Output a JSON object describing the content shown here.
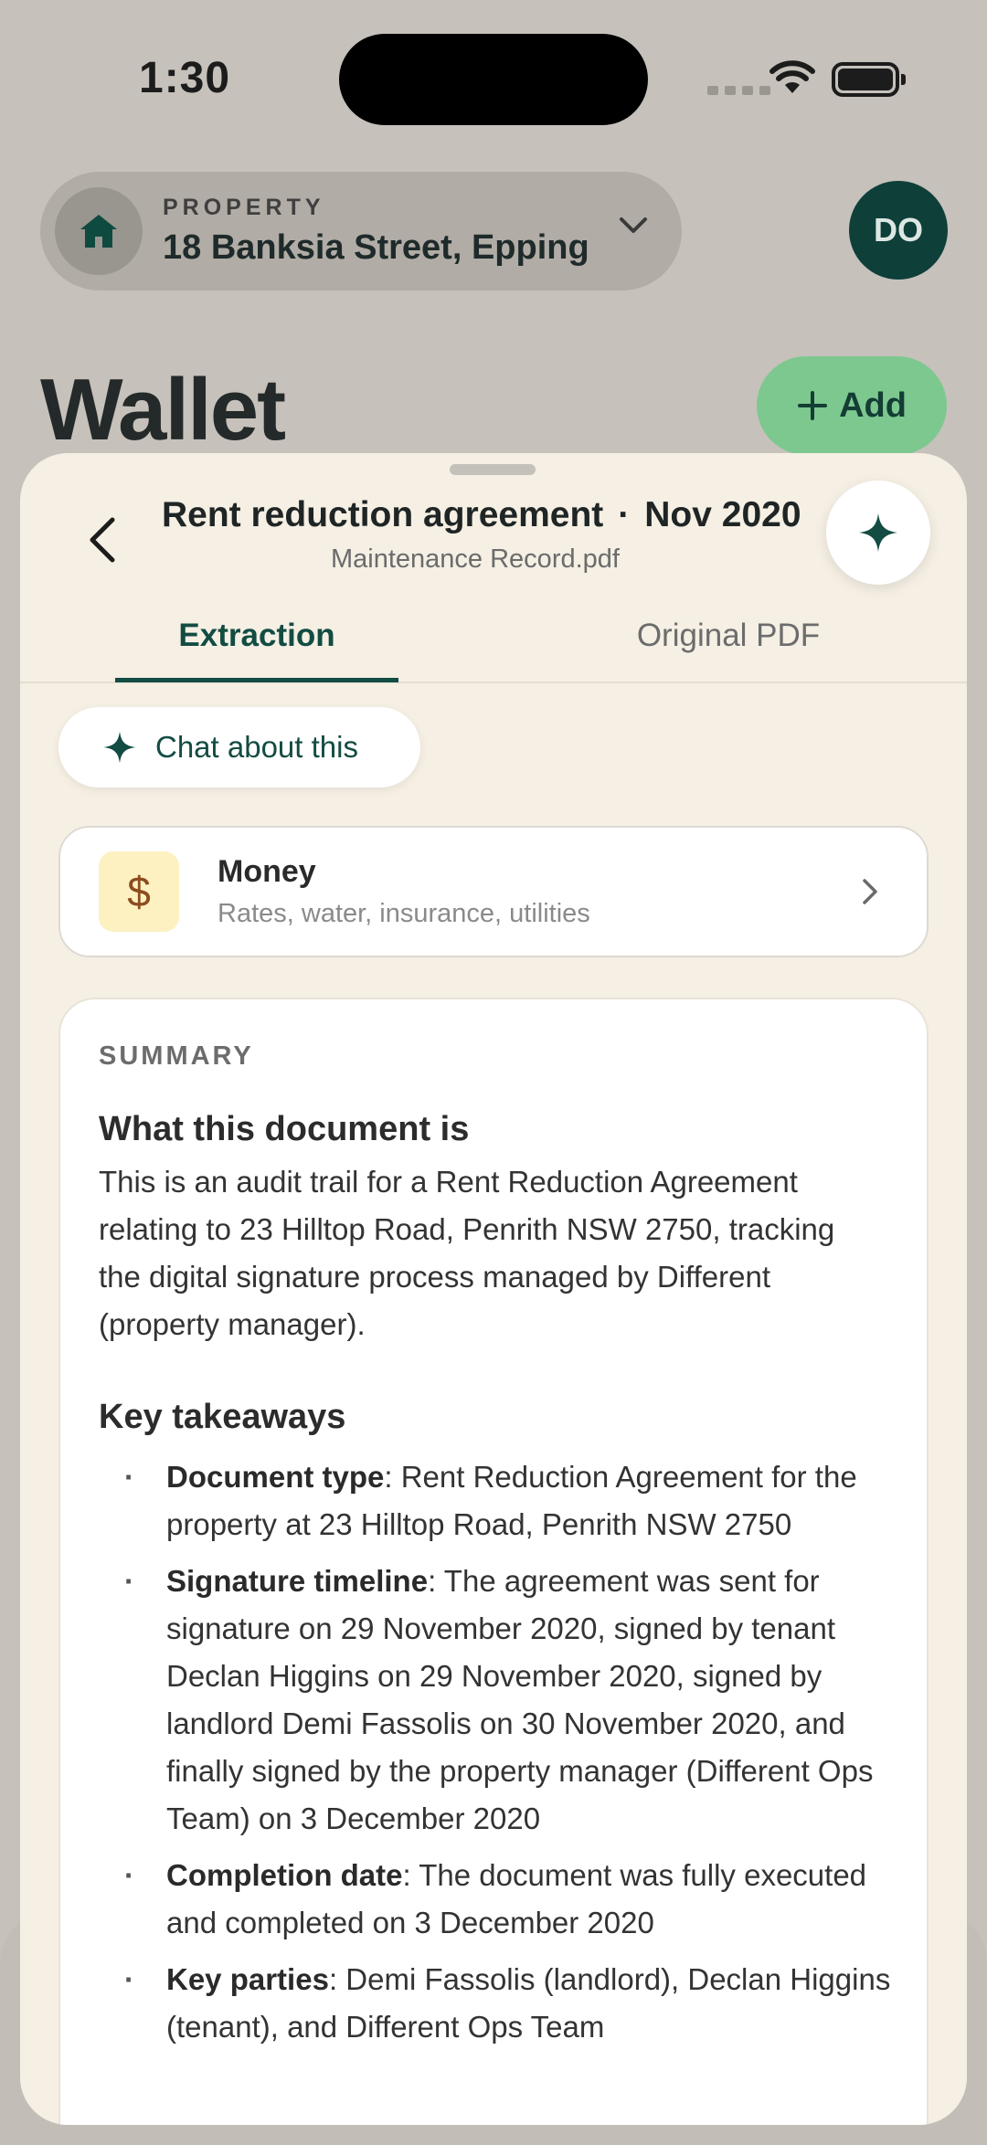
{
  "status_bar": {
    "time": "1:30"
  },
  "property": {
    "label": "PROPERTY",
    "address": "18 Banksia Street, Epping",
    "avatar_initials": "DO"
  },
  "wallet": {
    "title": "Wallet",
    "add_label": "Add"
  },
  "sheet": {
    "title": "Rent reduction agreement",
    "separator": "·",
    "date": "Nov 2020",
    "filename": "Maintenance Record.pdf",
    "tabs": [
      {
        "label": "Extraction",
        "active": true
      },
      {
        "label": "Original PDF",
        "active": false
      }
    ],
    "chat_label": "Chat about this",
    "category": {
      "icon_symbol": "$",
      "title": "Money",
      "subtitle": "Rates, water, insurance, utilities"
    },
    "summary": {
      "label": "SUMMARY",
      "what_heading": "What this document is",
      "what_body": "This is an audit trail for a Rent Reduction Agreement relating to 23 Hilltop Road, Penrith NSW 2750, tracking the digital signature process managed by Different (property manager).",
      "takeaways_heading": "Key takeaways",
      "takeaways": [
        {
          "term": "Document type",
          "text": ": Rent Reduction Agreement for the property at 23 Hilltop Road, Penrith NSW 2750"
        },
        {
          "term": "Signature timeline",
          "text": ": The agreement was sent for signature on 29 November 2020, signed by tenant Declan Higgins on 29 November 2020, signed by landlord Demi Fassolis on 30 November 2020, and finally signed by the property manager (Different Ops Team) on 3 December 2020"
        },
        {
          "term": "Completion date",
          "text": ": The document was fully executed and completed on 3 December 2020"
        },
        {
          "term": "Key parties",
          "text": ": Demi Fassolis (landlord), Declan Higgins (tenant), and Different Ops Team"
        }
      ]
    }
  },
  "colors": {
    "accent_dark_green": "#124c42",
    "avatar_green": "#0e3f39",
    "add_button_green": "#7dc88f",
    "sheet_background": "#f5efe4",
    "page_background": "#c6c1bb"
  }
}
